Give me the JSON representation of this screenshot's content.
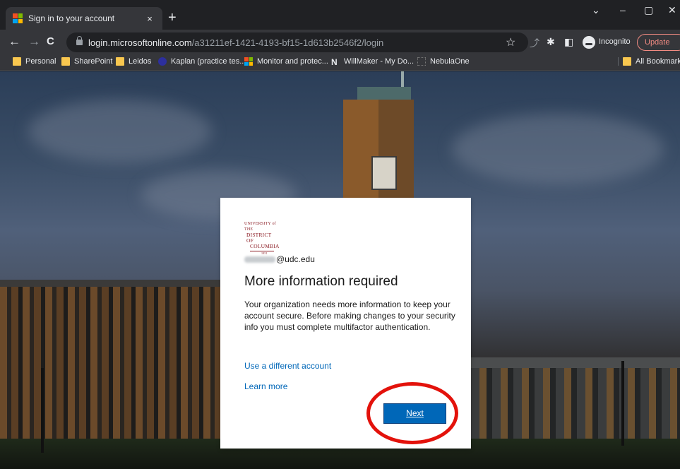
{
  "browser": {
    "tab": {
      "title": "Sign in to your account",
      "close": "×"
    },
    "new_tab": "+",
    "window_controls": {
      "dropdown": "⌄",
      "minimize": "–",
      "restore": "▢",
      "close": "✕"
    },
    "nav": {
      "back": "←",
      "forward": "→",
      "reload": "C"
    },
    "url": {
      "host": "login.microsoftonline.com",
      "path": "/a31211ef-1421-4193-bf15-1d613b2546f2/login"
    },
    "incognito_label": "Incognito",
    "update_label": "Update",
    "bookmarks": [
      {
        "label": "Personal",
        "icon": "folder-icon"
      },
      {
        "label": "SharePoint",
        "icon": "folder-icon"
      },
      {
        "label": "Leidos",
        "icon": "folder-icon"
      },
      {
        "label": "Kaplan (practice tes...",
        "icon": "globe-icon"
      },
      {
        "label": "Monitor and protec...",
        "icon": "microsoft-icon"
      },
      {
        "label": "WillMaker - My Do...",
        "icon": "n-icon"
      },
      {
        "label": "NebulaOne",
        "icon": "nebula-icon"
      }
    ],
    "all_bookmarks": "All Bookmarks"
  },
  "signin": {
    "logo": {
      "line1": "UNIVERSITY of THE",
      "line2": "DISTRICT OF",
      "line3": "COLUMBIA",
      "est": "1851"
    },
    "identity_domain": "@udc.edu",
    "heading": "More information required",
    "description": "Your organization needs more information to keep your account secure. Before making changes to your security info you must complete multifactor authentication.",
    "use_different_account": "Use a different account",
    "learn_more": "Learn more",
    "next_button": "Next"
  },
  "colors": {
    "accent": "#0067b8",
    "brand": "#8b1c24",
    "annotation": "#e3120b"
  }
}
